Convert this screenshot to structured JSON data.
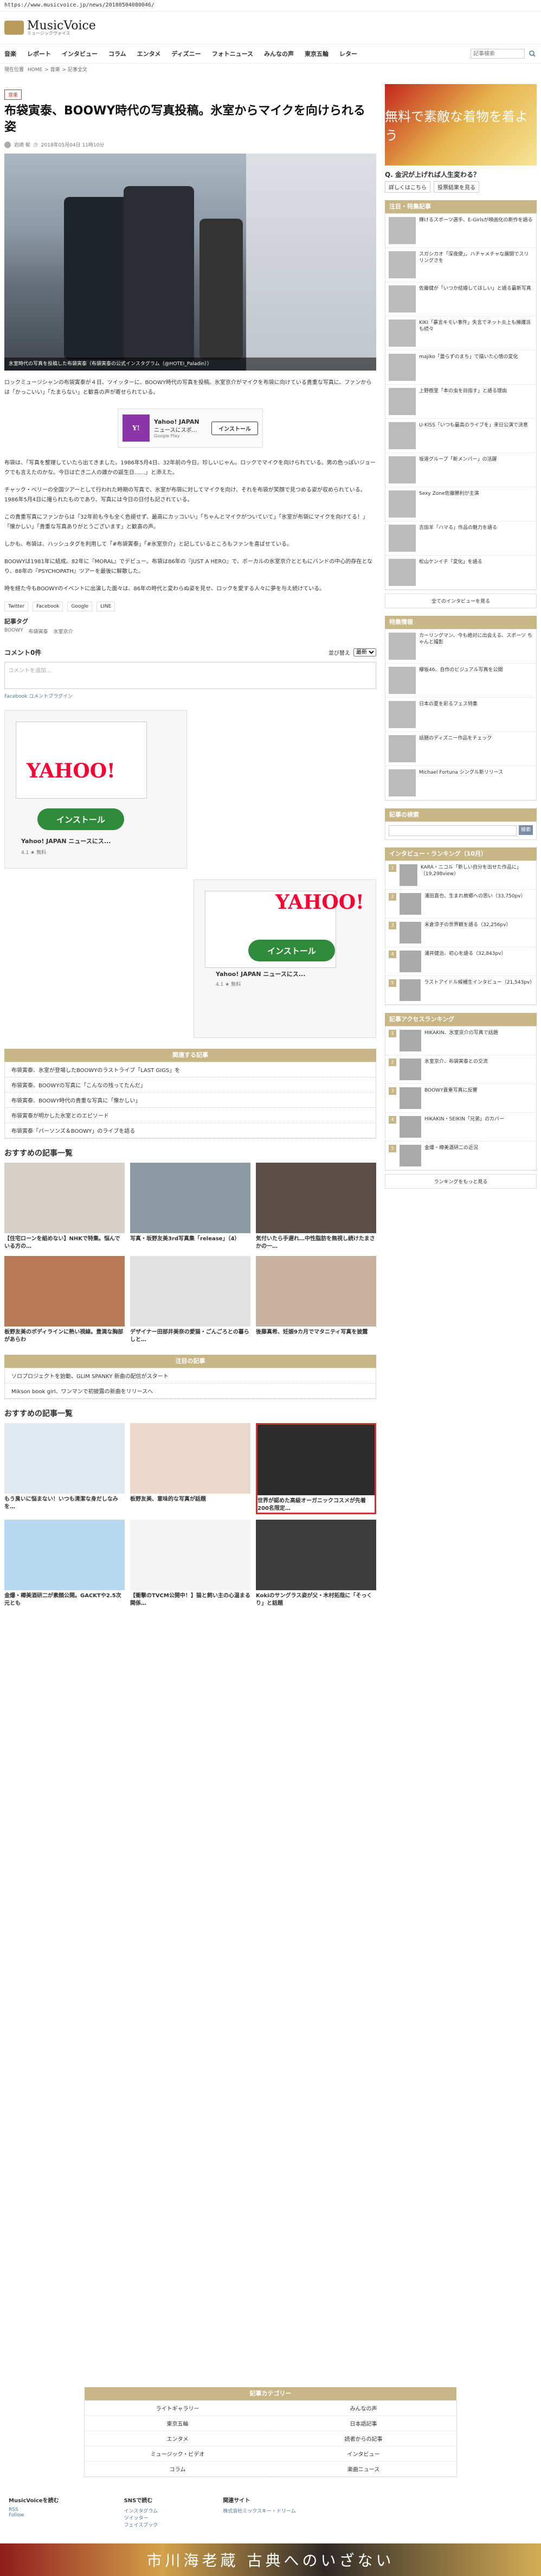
{
  "url": "https://www.musicvoice.jp/news/20180504080046/",
  "site": {
    "name": "MusicVoice",
    "tagline": "ミュージックヴォイス"
  },
  "nav": {
    "items": [
      "音楽",
      "レポート",
      "インタビュー",
      "コラム",
      "エンタメ",
      "ディズニー",
      "フォトニュース",
      "みんなの声",
      "東京五輪",
      "レター"
    ],
    "search_placeholder": "記事検索"
  },
  "breadcrumb": [
    "現在位置",
    "HOME",
    "音楽",
    "記事全文"
  ],
  "article": {
    "category": "音楽",
    "title": "布袋寅泰、BOOWY時代の写真投稿。氷室からマイクを向けられる姿",
    "author": "岩崎 郁",
    "date": "2018年05月04日 11時10分",
    "hero_caption": "氷室時代の写真を投稿した布袋寅泰（布袋寅泰の公式インスタグラム（@HOTEI_Paladin））",
    "paragraphs": [
      "ロックミュージシャンの布袋寅泰が４日、ツイッターに、BOOWY時代の写真を投稿。氷室京介がマイクを布袋に向けている貴重な写真に、ファンからは「かっこいい」「たまらない」と歓喜の声が寄せられている。",
      "布袋は、「写真を整理していたら出てきました。1986年5月4日、32年前の今日。珍しいじゃん。ロックでマイクを向けられている。男の色っぽいジョークでも言えたのかな。今日は亡き二人の誰かの誕生日……」と添えた。",
      "チャック・ベリーの全国ツアーとして行われた時期の写真で、氷室が布袋に対してマイクを向け、それを布袋が笑顔で見つめる姿が収められている。1986年5月4日に撮られたものであり、写真には今日の日付も記されている。",
      "この貴重写真にファンからは「32年前も今も全く色褪せず、最高にカッコいい」「ちゃんとマイクがついていて」「氷室が布袋にマイクを向けてる！」「懐かしい」「貴重な写真ありがとうございます」と歓喜の声。",
      "しかも、布袋は、ハッシュタグを利用して「#布袋寅泰」「#氷室京介」と記しているところもファンを喜ばせている。",
      "BOOWYは1981年に結成。82年に『MORAL』でデビュー。布袋は86年の『JUST A HERO』で、ボーカルの氷室京介とともにバンドの中心的存在となり、88年の『PSYCHOPATH』ツアーを最後に解散した。",
      "時を経た今もBOOWYのイベントに出演した面々は、86年の時代と変わらぬ姿を見せ、ロックを愛する人々に夢を与え続けている。"
    ],
    "share": [
      "Twitter",
      "Facebook",
      "Google",
      "LINE"
    ],
    "tags_title": "記事タグ",
    "tags": [
      "BOOWY",
      "布袋寅泰",
      "氷室京介"
    ]
  },
  "ad_inline": {
    "title": "Yahoo! JAPAN",
    "subtitle": "ニュースにスポ…",
    "button": "インストール",
    "source": "Google Play"
  },
  "comments": {
    "title": "コメント0件",
    "sort_label": "並び替え",
    "sort_value": "最新",
    "placeholder": "コメントを追加...",
    "plugin": "Facebook コメントプラグイン"
  },
  "yahoo_ads": [
    {
      "title": "Yahoo! JAPAN",
      "subtitle": "ニュースにス...",
      "rating": "4.1 ★ 無料",
      "button": "インストール",
      "logo": "YAHOO!"
    },
    {
      "title": "Yahoo! JAPAN",
      "subtitle": "ニュースにス...",
      "rating": "4.1 ★ 無料",
      "button": "インストール",
      "logo": "YAHOO!"
    }
  ],
  "related": {
    "header": "関連する記事",
    "items": [
      "布袋寅泰、氷室が登場したBOOWYのラストライブ「LAST GIGS」を",
      "布袋寅泰、BOOWYの写真に「こんなの残ってたんだ」",
      "布袋寅泰、BOOWY時代の貴重な写真に「懐かしい」",
      "布袋寅泰が明かした氷室とのエピソード",
      "布袋寅泰「パーソンズ＆BOOWY」のライブを語る"
    ]
  },
  "recommended": {
    "title": "おすすめの記事一覧",
    "items": [
      {
        "text": "【住宅ローンを組めない】NHKで特集。悩んでいる方の…",
        "source": "住宅ローン"
      },
      {
        "text": "写真・坂野友美3rd写真集「release」（4）",
        "source": ""
      },
      {
        "text": "気付いたら手遅れ…中性脂肪を無視し続けたまさかの一…",
        "source": ""
      },
      {
        "text": "板野友美のボディラインに熱い視線。豊満な胸部があらわ",
        "source": ""
      },
      {
        "text": "デザイナー田部井美奈の愛猫・ごんごろとの暮らしと…",
        "source": ""
      },
      {
        "text": "後藤真希、妊娠9カ月でマタニティ写真を披露",
        "source": ""
      }
    ]
  },
  "related2": {
    "header": "注目の記事",
    "items": [
      "ソロプロジェクトを始動、GLIM SPANKY 新曲の配信がスタート",
      "Mikson book girl、ワンマンで初披露の新曲をリリースへ"
    ]
  },
  "recommended2": {
    "title": "おすすめの記事一覧",
    "items": [
      {
        "text": "もう臭いに悩まない！いつも清潔な身だしなみを…",
        "source": ""
      },
      {
        "text": "板野友美、意味的な写真が話題",
        "source": ""
      },
      {
        "text": "世界が認めた高級オーガニックコスメが先着200名限定…",
        "source": ""
      },
      {
        "text": "金爆・樽美酒研二が素顔公開。GACKTや2.5次元とも",
        "source": ""
      },
      {
        "text": "【衝撃のTVCM公開中！】猫と飼い主の心温まる関係…",
        "source": ""
      },
      {
        "text": "Kokiのサングラス姿が父・木村拓哉に「そっくり」と話題",
        "source": ""
      }
    ]
  },
  "footer_nav": {
    "header": "記事カテゴリー",
    "items": [
      "ライトギャラリー",
      "みんなの声",
      "東京五輪",
      "日本語記事",
      "エンタメ",
      "読者からの記事",
      "ミュージック・ビデオ",
      "インタビュー",
      "コラム",
      "楽曲ニュース"
    ]
  },
  "footer_links": {
    "col1_title": "MusicVoiceを読む",
    "col1_items": [
      "RSS",
      "Follow"
    ],
    "col2_title": "SNSで読む",
    "col2_items": [
      "インスタグラム",
      "ツイッター",
      "フェイスブック"
    ],
    "col3_title": "関連サイト",
    "col3_items": [
      "株式会社ミックスキー・ドリーム"
    ]
  },
  "bottom_banner": {
    "text": "市川海老蔵 古典へのいざない"
  },
  "sidebar": {
    "ad_text": "無料で素敵な着物を着よう",
    "question": "Q. 金沢が上げれば人生変わる？",
    "btns": [
      "詳しくはこちら",
      "投票結果を見る"
    ],
    "tagged_header": "注目・特集記事",
    "tagged_items": [
      "輝けるスポーツ選手、E-Girlsが映画化の新作を語る",
      "スガシカオ「深夜便」。ハチャメチャな展開でスリリングさを",
      "佐藤健が「いつか結婚してほしい」と語る最新写真",
      "KIKI「暴言キモい事件」失言でネット炎上も擁護派も続々",
      "majiko「曇らずのまち」で描いた心情の変化",
      "上野樹里「本の虫を目指す」と語る理由",
      "U-KISS「いつも最高のライブを」来日公演で決意",
      "坂道グループ「新メンバー」の活躍",
      "Sexy Zone佐藤勝利が主演",
      "吉田羊「ハマる」作品の魅力を語る",
      "松山ケンイチ「変化」を語る"
    ],
    "more": "全てのインタビューを見る",
    "new_header": "特集情報",
    "new_items": [
      "カーリングマン、今も絶対に出会える、スポーツ ちゃんと撮影",
      "欅坂46、自作のビジュアル写真を公開",
      "日本の夏を彩るフェス特集",
      "話題のディズニー作品をチェック",
      "Michael Fortuna シングル新リリース"
    ],
    "search_header": "記事の検索",
    "search_btn": "検索",
    "ranking_header": "インタビュー・ランキング（10月）",
    "ranking_items": [
      "KARA・ニコル「新しい自分を出せた作品に」（19,298view）",
      "浦田直也、生まれ故郷への思い（33,750pv）",
      "米倉涼子の世界観を語る（32,256pv）",
      "浦井健治、初心を語る（32,843pv）",
      "ラストアイドル候補生インタビュー（21,543pv）"
    ],
    "access_header": "記事アクセスランキング",
    "access_items": [
      "HIKAKIN、氷室京介の写真で話題",
      "氷室京介、布袋寅泰との交流",
      "BOOWY貴重写真に反響",
      "HIKAKIN・SEIKIN「兄弟」のカバー",
      "金爆・樽美酒研二の近況"
    ],
    "access_more": "ランキングをもっと見る"
  }
}
